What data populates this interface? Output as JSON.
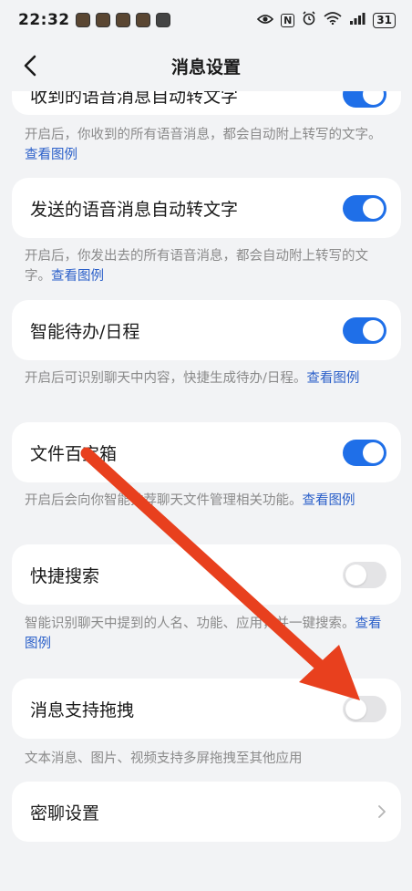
{
  "status": {
    "time": "22:32",
    "battery": "31",
    "nfc_label": "N"
  },
  "nav": {
    "title": "消息设置"
  },
  "settings": {
    "item0": {
      "label": "收到的语音消息自动转文字",
      "enabled": true
    },
    "desc0": {
      "text": "开启后，你收到的所有语音消息，都会自动附上转写的文字。",
      "link": "查看图例"
    },
    "item1": {
      "label": "发送的语音消息自动转文字",
      "enabled": true
    },
    "desc1": {
      "text": "开启后，你发出去的所有语音消息，都会自动附上转写的文字。",
      "link": "查看图例"
    },
    "item2": {
      "label": "智能待办/日程",
      "enabled": true
    },
    "desc2": {
      "text": "开启后可识别聊天中内容，快捷生成待办/日程。",
      "link": "查看图例"
    },
    "item3": {
      "label": "文件百宝箱",
      "enabled": true
    },
    "desc3": {
      "text": "开启后会向你智能推荐聊天文件管理相关功能。",
      "link": "查看图例"
    },
    "item4": {
      "label": "快捷搜索",
      "enabled": false
    },
    "desc4": {
      "text": "智能识别聊天中提到的人名、功能、应用，并一键搜索。",
      "link": "查看图例"
    },
    "item5": {
      "label": "消息支持拖拽",
      "enabled": false
    },
    "desc5": {
      "text": "文本消息、图片、视频支持多屏拖拽至其他应用"
    },
    "item6": {
      "label": "密聊设置"
    }
  },
  "colors": {
    "accent": "#1f6fe8",
    "link": "#2a5fc9",
    "annotation_arrow": "#e8401e"
  }
}
